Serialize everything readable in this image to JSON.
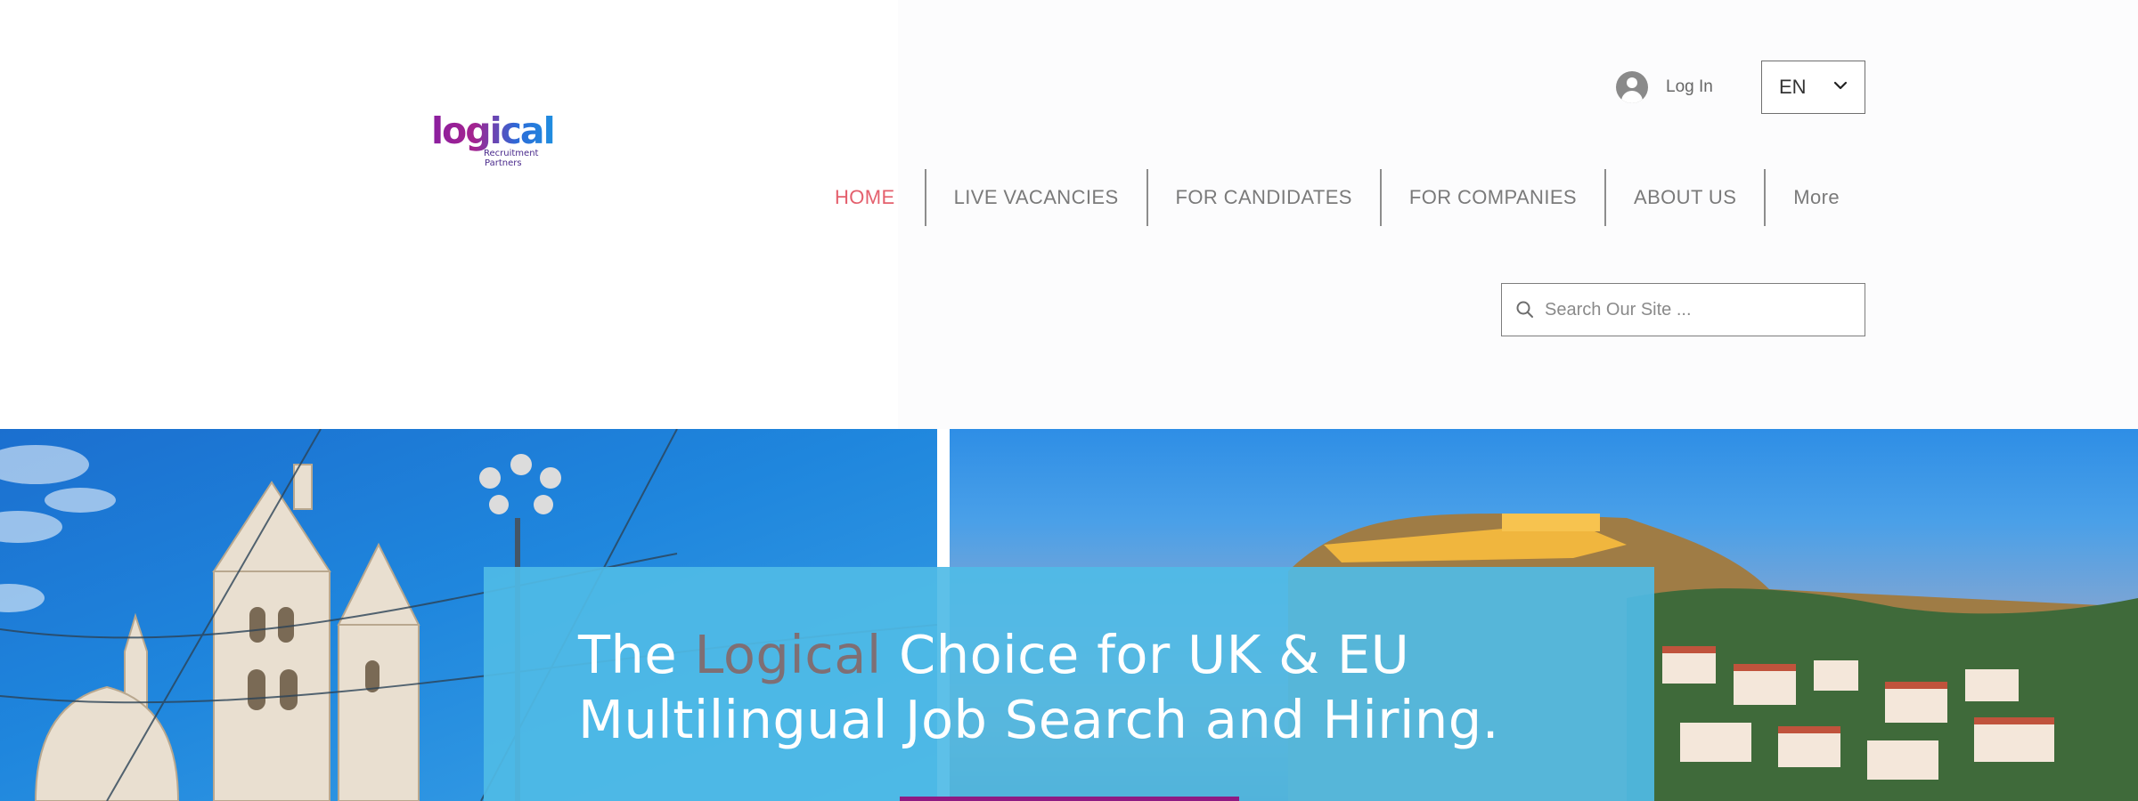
{
  "header": {
    "logo": {
      "word": "logical",
      "sub_line1": "Recruitment",
      "sub_line2": "Partners"
    },
    "login": {
      "label": "Log In",
      "icon": "user-avatar-icon"
    },
    "language": {
      "selected": "EN",
      "icon": "chevron-down-icon"
    },
    "nav": {
      "items": [
        {
          "label": "HOME",
          "active": true
        },
        {
          "label": "LIVE VACANCIES",
          "active": false
        },
        {
          "label": "FOR CANDIDATES",
          "active": false
        },
        {
          "label": "FOR COMPANIES",
          "active": false
        },
        {
          "label": "ABOUT US",
          "active": false
        },
        {
          "label": "More",
          "active": false
        }
      ]
    },
    "search": {
      "placeholder": "Search Our Site ...",
      "value": "",
      "icon": "search-icon"
    }
  },
  "hero": {
    "title_part1": "The ",
    "title_accent": "Logical",
    "title_part2": " Choice for UK & EU",
    "title_line2": "Multilingual Job Search and Hiring."
  },
  "colors": {
    "nav_active": "#e4606d",
    "nav_text": "#7a7a7a",
    "hero_panel": "#4fbbe6",
    "hero_accent_text": "#7f6f74",
    "cta_bar": "#8e1a83",
    "logo_purple": "#8a1ea0",
    "logo_blue": "#1f8fe0"
  }
}
